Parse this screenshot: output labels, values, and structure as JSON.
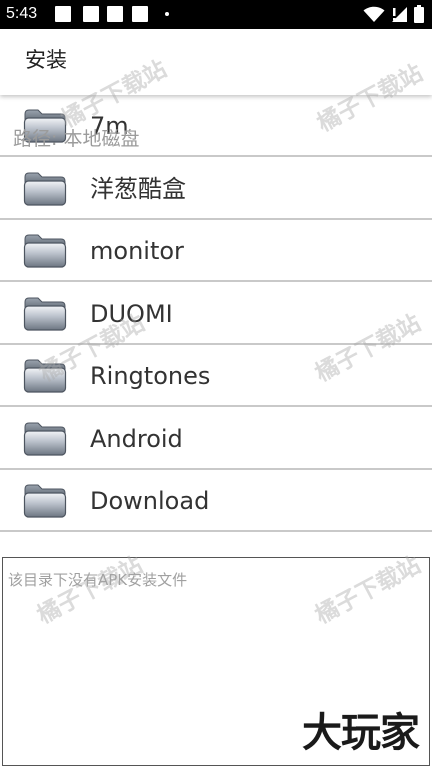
{
  "status_bar": {
    "time": "5:43"
  },
  "header": {
    "title": "安装"
  },
  "path": {
    "label": "路径:  本地磁盘"
  },
  "folders": [
    {
      "name": "7m"
    },
    {
      "name": "洋葱酷盒"
    },
    {
      "name": "monitor"
    },
    {
      "name": "DUOMI"
    },
    {
      "name": "Ringtones"
    },
    {
      "name": "Android"
    },
    {
      "name": "Download"
    }
  ],
  "log": {
    "message": "该目录下没有APK安装文件"
  },
  "brand": {
    "text": "大玩家"
  },
  "watermark": {
    "text": "橘子下载站"
  },
  "icons": {
    "folder": "folder-icon",
    "wifi": "wifi-icon",
    "signal": "cell-signal-icon",
    "battery": "battery-icon"
  },
  "colors": {
    "status_bar": "#000000",
    "divider": "#c9c9c9",
    "path_text": "#9b9b9b",
    "log_text": "#a0a0a0"
  }
}
